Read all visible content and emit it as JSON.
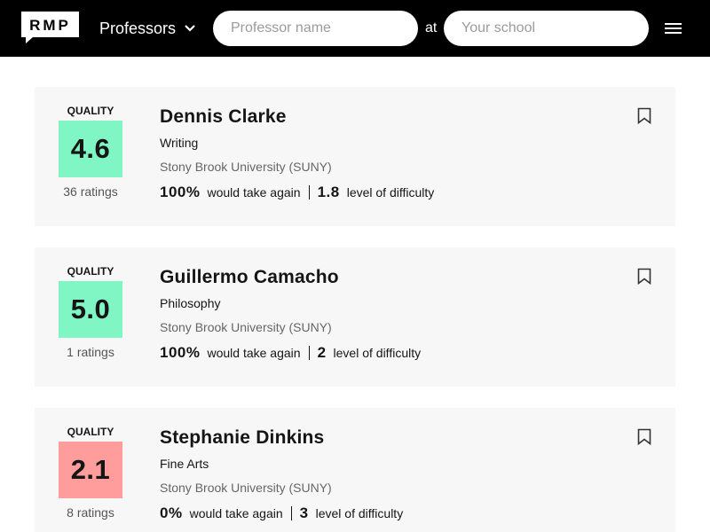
{
  "header": {
    "logo_text": "RMP",
    "search_type": "Professors",
    "professor_search": {
      "value": "",
      "placeholder": "Professor name"
    },
    "connector": "at",
    "school_search": {
      "value": "",
      "placeholder": "Your school"
    }
  },
  "colors": {
    "good_rating": "#7ff6c3",
    "poor_rating": "#ff9c9c"
  },
  "professors": [
    {
      "quality_label": "QUALITY",
      "quality": "4.6",
      "ratings": "36 ratings",
      "name": "Dennis Clarke",
      "department": "Writing",
      "school": "Stony Brook University (SUNY)",
      "would_take_again": "100%",
      "would_take_again_label": "would take again",
      "difficulty": "1.8",
      "difficulty_label": "level of difficulty"
    },
    {
      "quality_label": "QUALITY",
      "quality": "5.0",
      "ratings": "1 ratings",
      "name": "Guillermo Camacho",
      "department": "Philosophy",
      "school": "Stony Brook University (SUNY)",
      "would_take_again": "100%",
      "would_take_again_label": "would take again",
      "difficulty": "2",
      "difficulty_label": "level of difficulty"
    },
    {
      "quality_label": "QUALITY",
      "quality": "2.1",
      "ratings": "8 ratings",
      "name": "Stephanie Dinkins",
      "department": "Fine Arts",
      "school": "Stony Brook University (SUNY)",
      "would_take_again": "0%",
      "would_take_again_label": "would take again",
      "difficulty": "3",
      "difficulty_label": "level of difficulty"
    }
  ]
}
